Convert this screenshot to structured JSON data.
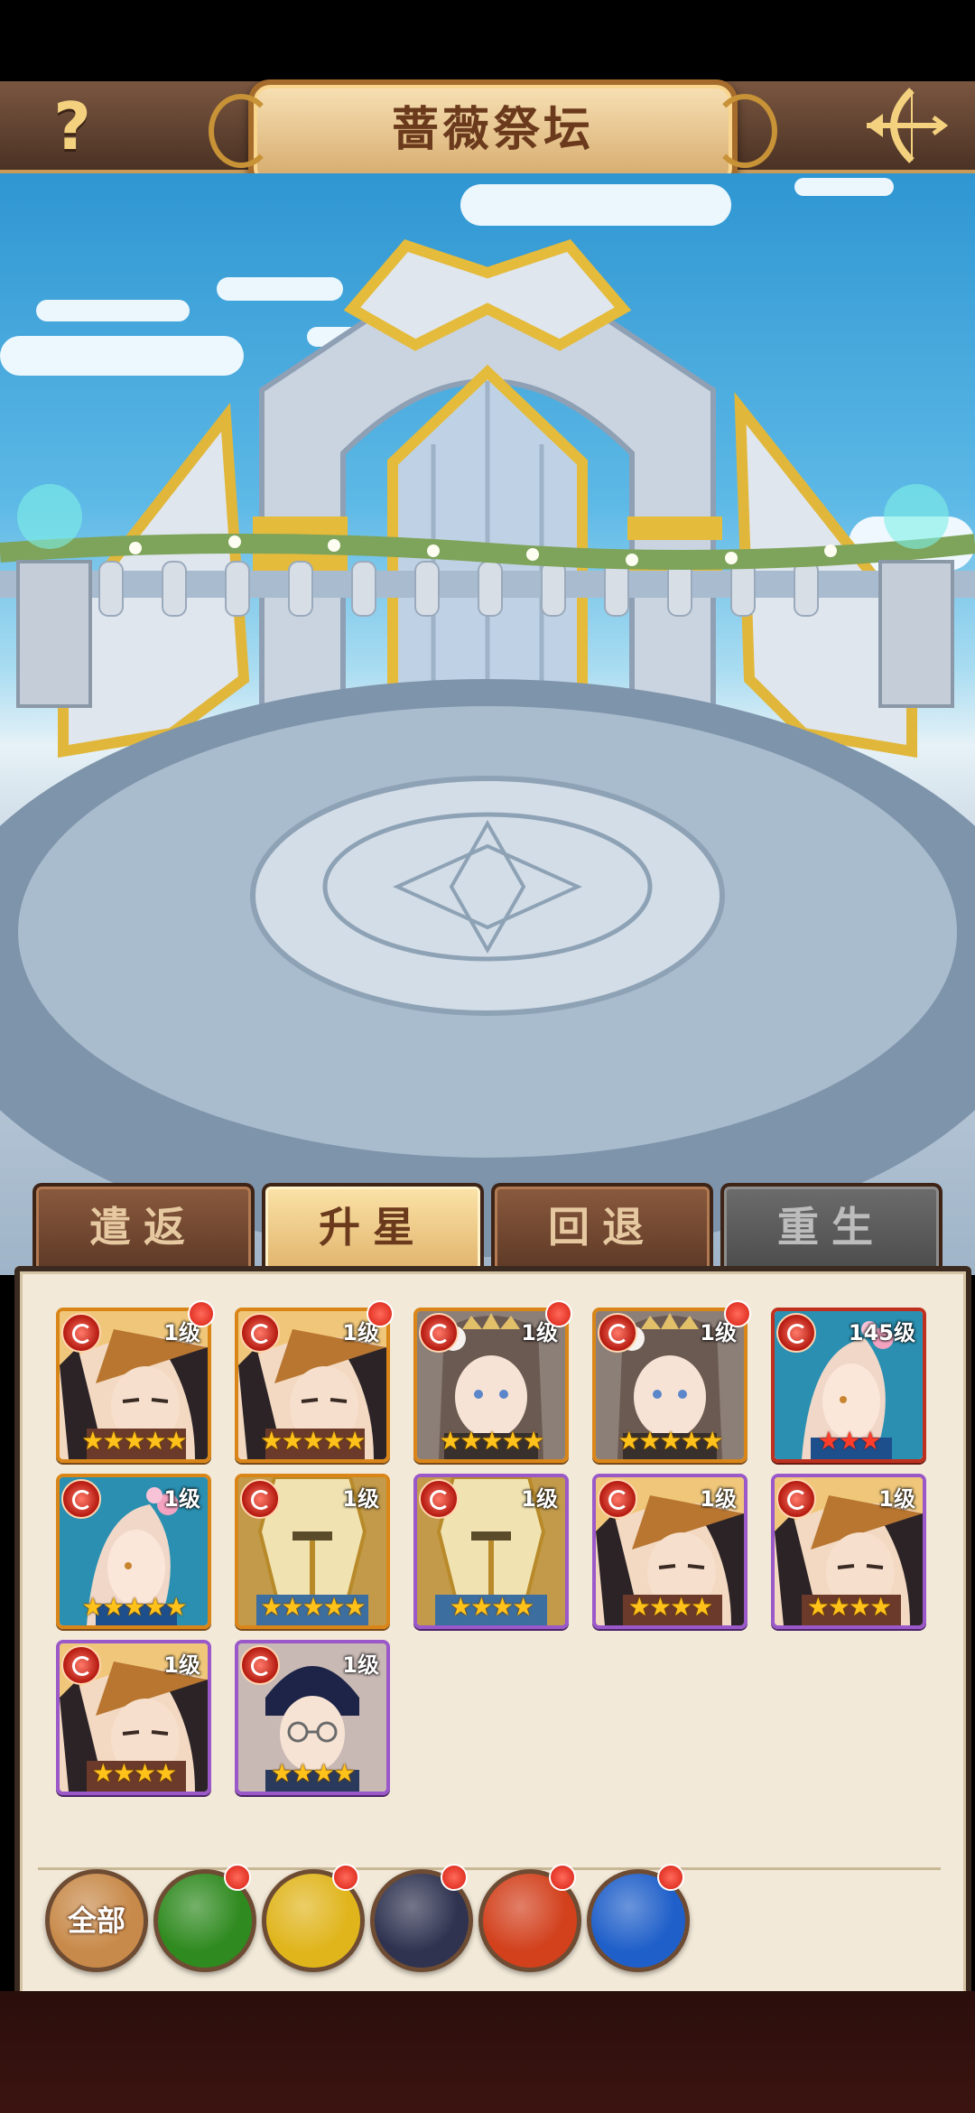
{
  "header": {
    "help_label": "?",
    "title": "蔷薇祭坛"
  },
  "tabs": [
    {
      "label": "遣返",
      "state": "normal"
    },
    {
      "label": "升星",
      "state": "active"
    },
    {
      "label": "回退",
      "state": "normal"
    },
    {
      "label": "重生",
      "state": "disabled"
    }
  ],
  "heroes": [
    {
      "level": "1级",
      "rarity": "orange",
      "stars": 5,
      "star_color": "gold",
      "dot": true,
      "portrait": "dark-hair-hat-hero"
    },
    {
      "level": "1级",
      "rarity": "orange",
      "stars": 5,
      "star_color": "gold",
      "dot": true,
      "portrait": "dark-hair-hat-hero"
    },
    {
      "level": "1级",
      "rarity": "orange",
      "stars": 5,
      "star_color": "gold",
      "dot": true,
      "portrait": "crowned-lady-hero"
    },
    {
      "level": "1级",
      "rarity": "orange",
      "stars": 5,
      "star_color": "gold",
      "dot": true,
      "portrait": "crowned-lady-hero"
    },
    {
      "level": "145级",
      "rarity": "red",
      "stars": 3,
      "star_color": "red",
      "dot": false,
      "portrait": "teal-hair-flower-hero"
    },
    {
      "level": "1级",
      "rarity": "orange",
      "stars": 5,
      "star_color": "gold",
      "dot": false,
      "portrait": "teal-hair-flower-hero"
    },
    {
      "level": "1级",
      "rarity": "orange",
      "stars": 5,
      "star_color": "gold",
      "dot": false,
      "portrait": "golden-knight-hero"
    },
    {
      "level": "1级",
      "rarity": "purple",
      "stars": 4,
      "star_color": "gold",
      "dot": false,
      "portrait": "golden-knight-hero"
    },
    {
      "level": "1级",
      "rarity": "purple",
      "stars": 4,
      "star_color": "gold",
      "dot": false,
      "portrait": "dark-hair-hat-hero"
    },
    {
      "level": "1级",
      "rarity": "purple",
      "stars": 4,
      "star_color": "gold",
      "dot": false,
      "portrait": "dark-hair-hat-hero"
    },
    {
      "level": "1级",
      "rarity": "purple",
      "stars": 4,
      "star_color": "gold",
      "dot": false,
      "portrait": "dark-hair-hat-hero"
    },
    {
      "level": "1级",
      "rarity": "purple",
      "stars": 4,
      "star_color": "gold",
      "dot": false,
      "portrait": "glasses-man-hero"
    }
  ],
  "filters": [
    {
      "label": "全部",
      "icon": "all-filter-icon",
      "color": "#c88a4a",
      "dot": false
    },
    {
      "label": "",
      "icon": "green-dragon-icon",
      "color": "#2f8a1f",
      "dot": true
    },
    {
      "label": "",
      "icon": "yellow-rose-icon",
      "color": "#e0b51c",
      "dot": true
    },
    {
      "label": "",
      "icon": "dark-star-icon",
      "color": "#2f3350",
      "dot": true
    },
    {
      "label": "",
      "icon": "red-phoenix-icon",
      "color": "#d2401c",
      "dot": true
    },
    {
      "label": "",
      "icon": "blue-serpent-icon",
      "color": "#1f5fc9",
      "dot": true
    }
  ]
}
